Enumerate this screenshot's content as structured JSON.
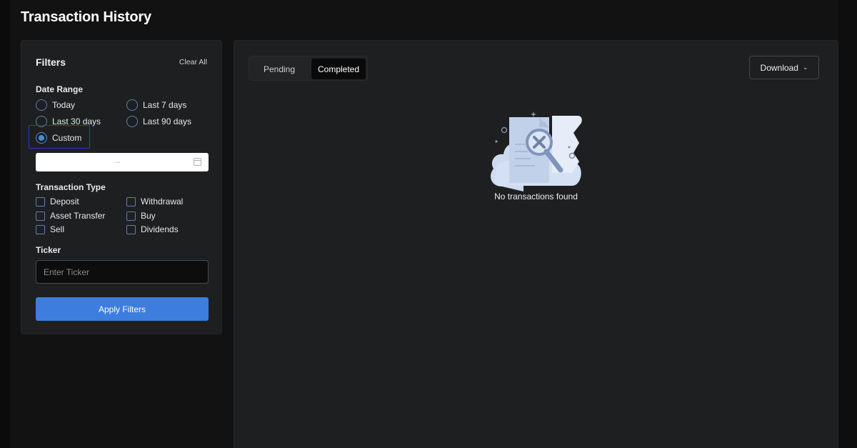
{
  "page": {
    "title": "Transaction History"
  },
  "filters": {
    "title": "Filters",
    "clear_all": "Clear All",
    "date_range": {
      "label": "Date Range",
      "options": [
        "Today",
        "Last 7 days",
        "Last 30 days",
        "Last 90 days",
        "Custom"
      ],
      "selected": "Custom"
    },
    "date_input": {
      "separator": "→"
    },
    "transaction_type": {
      "label": "Transaction Type",
      "options": [
        "Deposit",
        "Withdrawal",
        "Asset Transfer",
        "Buy",
        "Sell",
        "Dividends"
      ]
    },
    "ticker": {
      "label": "Ticker",
      "placeholder": "Enter Ticker",
      "value": ""
    },
    "apply_label": "Apply Filters"
  },
  "main": {
    "tabs": [
      {
        "label": "Pending",
        "active": false
      },
      {
        "label": "Completed",
        "active": true
      }
    ],
    "download_label": "Download",
    "empty_message": "No transactions found"
  },
  "colors": {
    "accent": "#3c7ddd",
    "highlight": "#2a3ad8",
    "panel": "#1e1f20",
    "background": "#121212"
  }
}
